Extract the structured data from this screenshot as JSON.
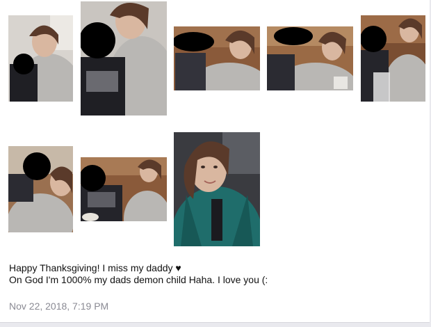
{
  "post": {
    "line1": "Happy Thanksgiving! I miss my daddy ♥",
    "line2": "On God I'm 1000% my dads demon child Haha. I love you (:",
    "timestamp": "Nov 22, 2018, 7:19 PM"
  },
  "photos": [
    {
      "name": "photo-1"
    },
    {
      "name": "photo-2"
    },
    {
      "name": "photo-3"
    },
    {
      "name": "photo-4"
    },
    {
      "name": "photo-5"
    },
    {
      "name": "photo-6"
    },
    {
      "name": "photo-7"
    },
    {
      "name": "photo-8"
    }
  ],
  "colors": {
    "hoodie_gray": "#b9b7b4",
    "hair_brown": "#5a3a2a",
    "skin": "#d9b7a0",
    "jacket_teal": "#1f6d6b",
    "wood": "#8a5a3a",
    "redaction": "#000000",
    "timestamp_gray": "#8a8a93"
  }
}
